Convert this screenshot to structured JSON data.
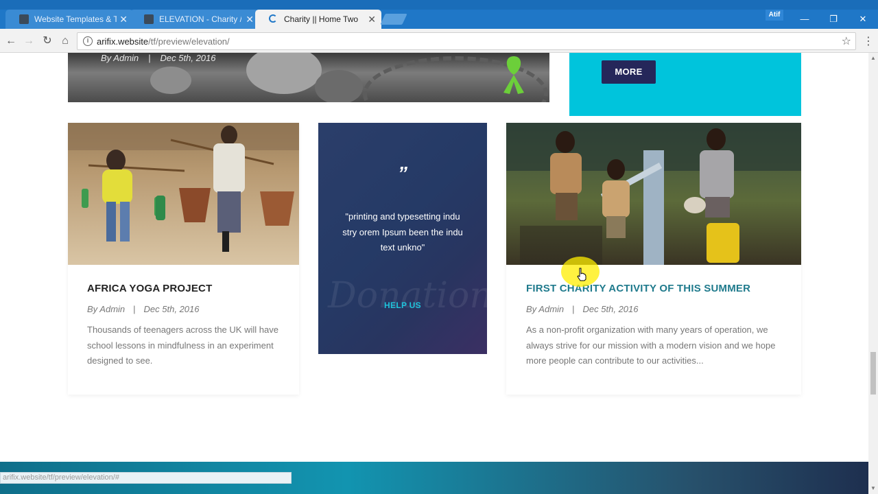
{
  "browser": {
    "tabs": [
      {
        "label": "Website Templates & Th",
        "active": false,
        "icon": "themeforest-icon"
      },
      {
        "label": "ELEVATION - Charity / N",
        "active": false,
        "icon": "themeforest-icon"
      },
      {
        "label": "Charity || Home Two",
        "active": true,
        "icon": "loading-icon"
      }
    ],
    "user_badge": "Atif",
    "url_host": "arifix.website",
    "url_path": "/tf/preview/elevation/",
    "status_url": "arifix.website/tf/preview/elevation/#",
    "window_controls": [
      "minimize",
      "restore",
      "close"
    ]
  },
  "page": {
    "top_card": {
      "author": "By Admin",
      "separator": "|",
      "date": "Dec 5th, 2016"
    },
    "cta_block": {
      "more_label": "MORE"
    },
    "cards": [
      {
        "title": "AFRICA YOGA PROJECT",
        "author": "By Admin",
        "separator": "|",
        "date": "Dec 5th, 2016",
        "text": "Thousands of teenagers across the UK will have school lessons in mindfulness in an experiment designed to see."
      },
      {
        "title": "FIRST CHARITY ACTIVITY OF THIS SUMMER",
        "author": "By Admin",
        "separator": "|",
        "date": "Dec 5th, 2016",
        "text": "As a non-profit organization with many years of operation, we always strive for our mission with a modern vision and we hope more people can contribute to our activities..."
      }
    ],
    "donate_box": {
      "quote_mark": "”",
      "quote": "\"printing and typesetting indu stry orem Ipsum been the indu text unkno\"",
      "watermark": "Donations",
      "button_label": "HELP US"
    }
  },
  "colors": {
    "accent_cyan": "#00c4dc",
    "navy": "#25275a",
    "title_teal": "#1f7a8c"
  }
}
